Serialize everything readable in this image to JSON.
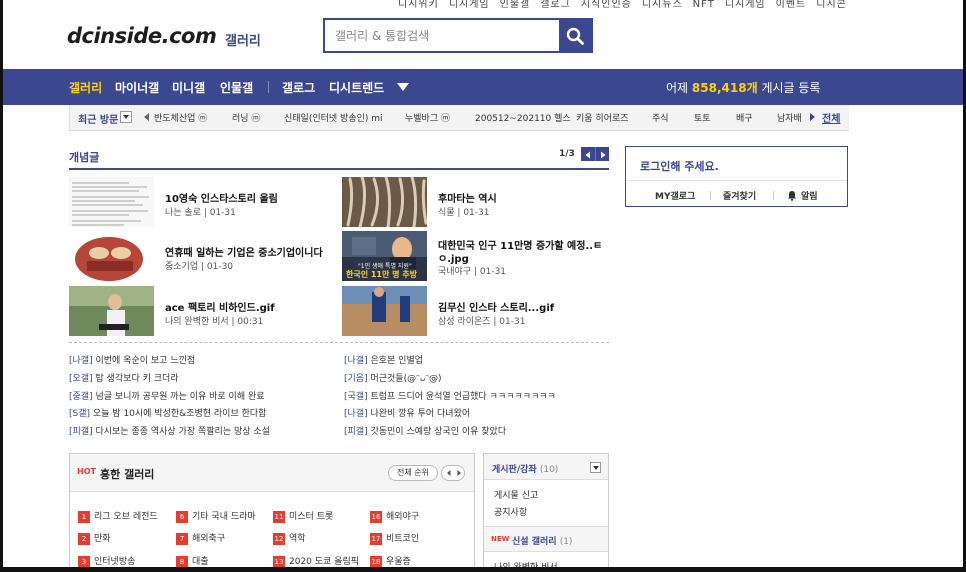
{
  "header": {
    "top_links": [
      "디시위키",
      "디시게임",
      "인물갤",
      "갤로그",
      "지식인인증",
      "디시뉴스",
      "NFT",
      "디시게임",
      "이벤트",
      "디시콘"
    ],
    "logo": "dcinside.com",
    "logo_sub": "갤러리",
    "search_placeholder": "갤러리 & 통합검색"
  },
  "nav": {
    "items": [
      "갤러리",
      "마이너갤",
      "미니갤",
      "인물갤",
      "갤로그",
      "디시트렌드"
    ],
    "visit_prefix": "어제",
    "visit_count": "858,418개",
    "visit_suffix": "게시글 등록"
  },
  "recent": {
    "label": "최근 방문",
    "items": [
      "반도체산업 ⓜ",
      "러닝 ⓜ",
      "신태일(인터넷 방송인) mi",
      "누벨바그 ⓜ",
      "200512~202110 헬스",
      "키움 히어로즈",
      "주식",
      "토토",
      "배구",
      "남자배"
    ],
    "all": "전체"
  },
  "concept": {
    "title": "개념글",
    "page": "1/3",
    "cards": [
      {
        "title": "10영숙 인스타스토리 올림",
        "meta": "나는 솔로 | 01-31"
      },
      {
        "title": "후마타는 역시",
        "meta": "식물 | 01-31"
      },
      {
        "title": "연휴때 일하는 기업은 중소기업이니다",
        "meta": "중소기업 | 01-30"
      },
      {
        "title": "대한민국 인구 11만명 증가할 예정..ㅌ",
        "title2": "ㅇ.jpg",
        "meta": "국내야구 | 01-31"
      },
      {
        "title": "ace 팩토리 비하인드.gif",
        "meta": "나의 완벽한 비서 | 00:31"
      },
      {
        "title": "김무신 인스타 스토리...gif",
        "meta": "삼성 라이온즈 | 01-31"
      }
    ],
    "thumb_caption_1": "\"1인 생애 특별 지원\"",
    "thumb_caption_2": "한국인 11만 명 추방"
  },
  "posts_left": [
    {
      "tag": "[나갤]",
      "text": "이번에 옥순이 보고 느낀점"
    },
    {
      "tag": "[오갤]",
      "text": "탑 생각보다 키 크더라"
    },
    {
      "tag": "[중갤]",
      "text": "넘글 보니까 공무원 까는 이유 바로 이해 완료"
    },
    {
      "tag": "[S갤]",
      "text": "오늘 밤 10시에 박성한&조병현 라이브 한다함"
    },
    {
      "tag": "[피갤]",
      "text": "다시보는 종종 역사상 가장 쪽팔리는 망상 소설"
    }
  ],
  "posts_right": [
    {
      "tag": "[나갤]",
      "text": "은호본 인별업"
    },
    {
      "tag": "[기음]",
      "text": "머근것들(@ᵔᴗᵔ@)"
    },
    {
      "tag": "[국갤]",
      "text": "트럼프 드디어 윤석열 언급했다 ㅋㅋㅋㅋㅋㅋㅋㅋ"
    },
    {
      "tag": "[나갤]",
      "text": "나완비 깡유 투어 다녀왔어"
    },
    {
      "tag": "[피갤]",
      "text": "갓동민이 스예랑 상국인 이유 찾았다"
    }
  ],
  "hot": {
    "badge": "HOT",
    "title": "흥한 갤러리",
    "rank_btn": "전체 순위",
    "items": [
      {
        "n": "1",
        "name": "리그 오브 레전드"
      },
      {
        "n": "6",
        "name": "기타 국내 드라마"
      },
      {
        "n": "11",
        "name": "미스터 트롯"
      },
      {
        "n": "16",
        "name": "해외야구"
      },
      {
        "n": "2",
        "name": "만화"
      },
      {
        "n": "7",
        "name": "해외축구"
      },
      {
        "n": "12",
        "name": "역학"
      },
      {
        "n": "17",
        "name": "비트코인"
      },
      {
        "n": "3",
        "name": "인터넷방송"
      },
      {
        "n": "8",
        "name": "대출"
      },
      {
        "n": "13",
        "name": "2020 도쿄 올림픽"
      },
      {
        "n": "18",
        "name": "우울증"
      }
    ]
  },
  "board": {
    "title": "게시판/강좌",
    "count": "(10)",
    "links": [
      "게시물 신고",
      "공지사항"
    ],
    "new_badge": "NEW",
    "new_title": "신설 갤러리",
    "new_count": "(1)",
    "new_item": "나의 완벽한 비서"
  },
  "login": {
    "text": "로그인해 주세요.",
    "links": [
      "MY갤로그",
      "즐겨찾기",
      "알림"
    ]
  },
  "colors": {
    "brand": "#3b4890",
    "hot": "#e53d2f",
    "count": "#ffd200"
  }
}
